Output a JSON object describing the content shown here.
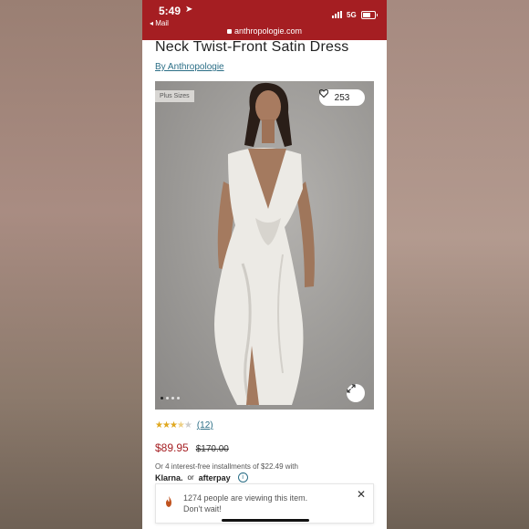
{
  "status_bar": {
    "time": "5:49",
    "back_app": "◂ Mail",
    "network": "5G",
    "url": "anthropologie.com"
  },
  "product": {
    "title": "Neck Twist-Front Satin Dress",
    "brand": "By Anthropologie",
    "badge": "Plus Sizes",
    "favorites_count": "253",
    "image_count": 4,
    "active_image": 1,
    "rating": 3.5,
    "review_count": "(12)",
    "sale_price": "$89.95",
    "original_price": "$170.00"
  },
  "payment": {
    "installments_text": "Or 4 interest-free installments of $22.49 with",
    "klarna": "Klarna.",
    "or": "or",
    "afterpay": "afterpay"
  },
  "toast": {
    "message_line1": "1274 people are viewing this item.",
    "message_line2": "Don't wait!",
    "close": "✕"
  },
  "colors": {
    "brand_red": "#a51e22",
    "link_blue": "#2b6e86",
    "star_gold": "#e0a820"
  },
  "icons": [
    "navigation-arrow-icon",
    "signal-icon",
    "battery-icon",
    "lock-icon",
    "heart-icon",
    "expand-icon",
    "star-icon",
    "info-icon",
    "fire-icon",
    "close-icon"
  ]
}
